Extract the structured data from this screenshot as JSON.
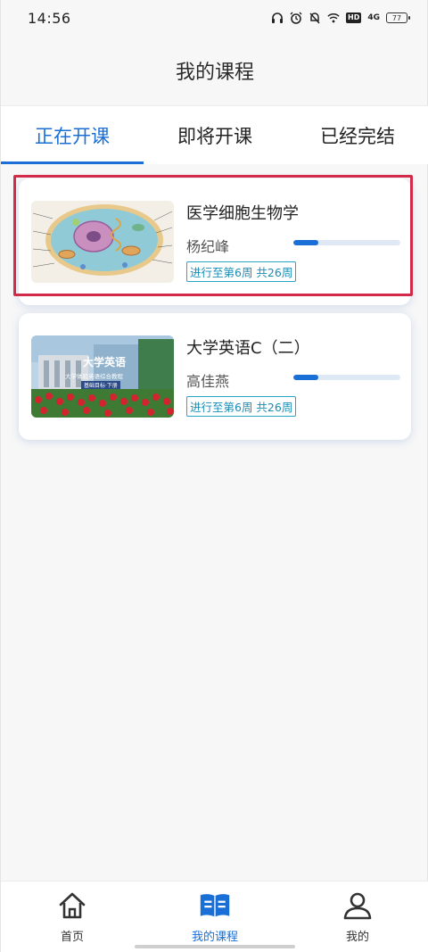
{
  "status_bar": {
    "time": "14:56",
    "icons": [
      "headphone-icon",
      "alarm-icon",
      "mute-icon",
      "wifi-icon",
      "hd-icon",
      "signal-4g-icon",
      "battery-icon"
    ],
    "hd_label": "HD",
    "network_label": "4G",
    "battery_level": "77"
  },
  "header": {
    "title": "我的课程"
  },
  "tabs": [
    {
      "label": "正在开课",
      "active": true
    },
    {
      "label": "即将开课",
      "active": false
    },
    {
      "label": "已经完结",
      "active": false
    }
  ],
  "courses": [
    {
      "name": "医学细胞生物学",
      "teacher": "杨纪峰",
      "progress_fraction": 0.23,
      "progress_text": "进行至第6周  共26周",
      "thumbnail": "cell-diagram-image",
      "selected": true
    },
    {
      "name": "大学英语C（二）",
      "teacher": "高佳燕",
      "progress_fraction": 0.23,
      "progress_text": "进行至第6周  共26周",
      "thumbnail": "english-textbook-cover-image",
      "thumb_title": "大学英语",
      "thumb_subtitle": "大学体验英语综合教程",
      "thumb_tag": "基础目标·下册",
      "selected": false
    }
  ],
  "bottom_nav": [
    {
      "label": "首页",
      "icon": "home-icon",
      "active": false
    },
    {
      "label": "我的课程",
      "icon": "book-icon",
      "active": true
    },
    {
      "label": "我的",
      "icon": "user-icon",
      "active": false
    }
  ],
  "colors": {
    "accent": "#1a6fd6",
    "selection": "#d42a4a",
    "tag_border": "#2aa6c8"
  }
}
